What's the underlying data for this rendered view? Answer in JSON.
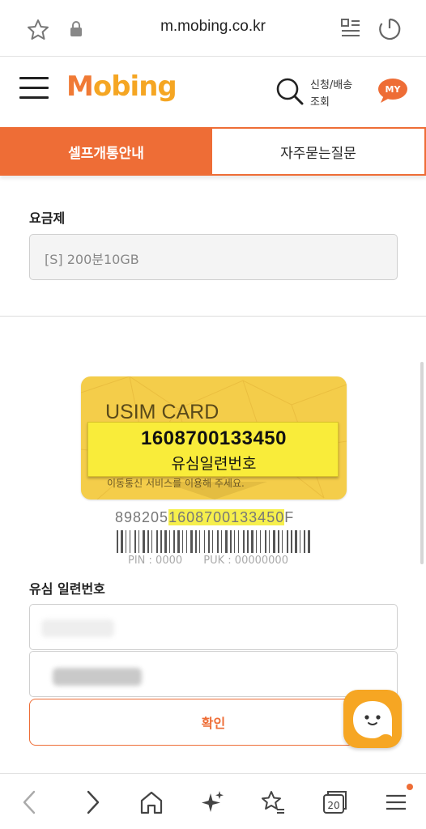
{
  "browser": {
    "url": "m.mobing.co.kr",
    "icons": [
      "star-icon",
      "lock-icon",
      "reader-mode-icon",
      "reload-icon"
    ]
  },
  "header": {
    "logo_m": "M",
    "logo_rest": "obing",
    "apply_line1": "신청/배송",
    "apply_line2": "조회",
    "my_label": "MY"
  },
  "tabs": [
    {
      "label": "셀프개통안내",
      "active": true
    },
    {
      "label": "자주묻는질문",
      "active": false
    }
  ],
  "plan": {
    "label": "요금제",
    "value": "[S] 200분10GB"
  },
  "card": {
    "title": "USIM CARD",
    "serial": "1608700133450",
    "serial_caption": "유심일련번호",
    "subtext": "이동통신 서비스를 이용해 주세요.",
    "iccid_prefix": "898205",
    "iccid_serial": "1608700133450",
    "iccid_suffix": "F",
    "pin": "PIN : 0000",
    "puk": "PUK : 00000000"
  },
  "serial_input": {
    "label": "유심 일련번호"
  },
  "confirm_label": "확인",
  "bottom_nav": {
    "icons": [
      "back-icon",
      "forward-icon",
      "home-icon",
      "sparkle-icon",
      "bookmarks-icon",
      "tabs-icon",
      "menu-icon"
    ],
    "tab_count": "20"
  },
  "colors": {
    "accent": "#ee6d36",
    "logo_orange": "#f5a623",
    "card_yellow": "#f4cd4a",
    "highlight_yellow": "#f9ec3a"
  }
}
